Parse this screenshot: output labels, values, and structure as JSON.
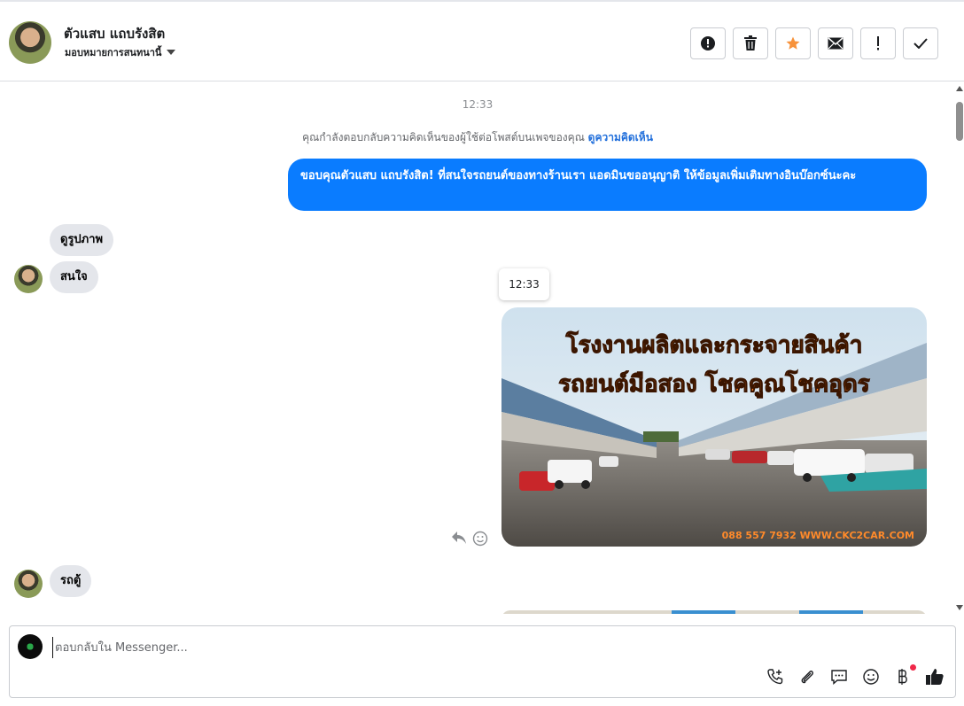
{
  "header": {
    "contact_name": "ตัวแสบ แถบรังสิต",
    "assign_label": "มอบหมายการสนทนานี้",
    "actions": [
      {
        "icon": "alert-circle-icon",
        "label": "spam"
      },
      {
        "icon": "trash-icon",
        "label": "delete"
      },
      {
        "icon": "star-icon",
        "label": "star"
      },
      {
        "icon": "envelope-icon",
        "label": "mark-unread"
      },
      {
        "icon": "exclamation-icon",
        "label": "follow-up"
      },
      {
        "icon": "check-icon",
        "label": "done"
      }
    ],
    "star_color": "#f7923a"
  },
  "conversation": {
    "timestamp_top": "12:33",
    "notice_text": "คุณกำลังตอบกลับความคิดเห็นของผู้ใช้ต่อโพสต์บนเพจของคุณ",
    "notice_link": "ดูความคิดเห็น",
    "outgoing_message": "ขอบคุณตัวแสบ แถบรังสิต! ที่สนใจรถยนต์ของทางร้านเรา แอดมินขออนุญาติ ให้ข้อมูลเพิ่มเติมทางอินบ๊อกซ์นะคะ",
    "incoming_1": "ดูรูปภาพ",
    "incoming_2": "สนใจ",
    "hover_timestamp": "12:33",
    "photo": {
      "line1": "โรงงานผลิตและกระจายสินค้า",
      "line2": "รถยนต์มือสอง โชคคูณโชคอุดร",
      "footer": "088 557 7932 WWW.CKC2CAR.COM"
    },
    "incoming_3": "รถตู้",
    "outgoing_color": "#0a7cff"
  },
  "composer": {
    "placeholder": "ตอบกลับใน Messenger...",
    "tools": [
      "phone-plus-icon",
      "paperclip-icon",
      "saved-reply-icon",
      "emoji-icon",
      "baht-icon",
      "thumbs-up-icon"
    ]
  }
}
